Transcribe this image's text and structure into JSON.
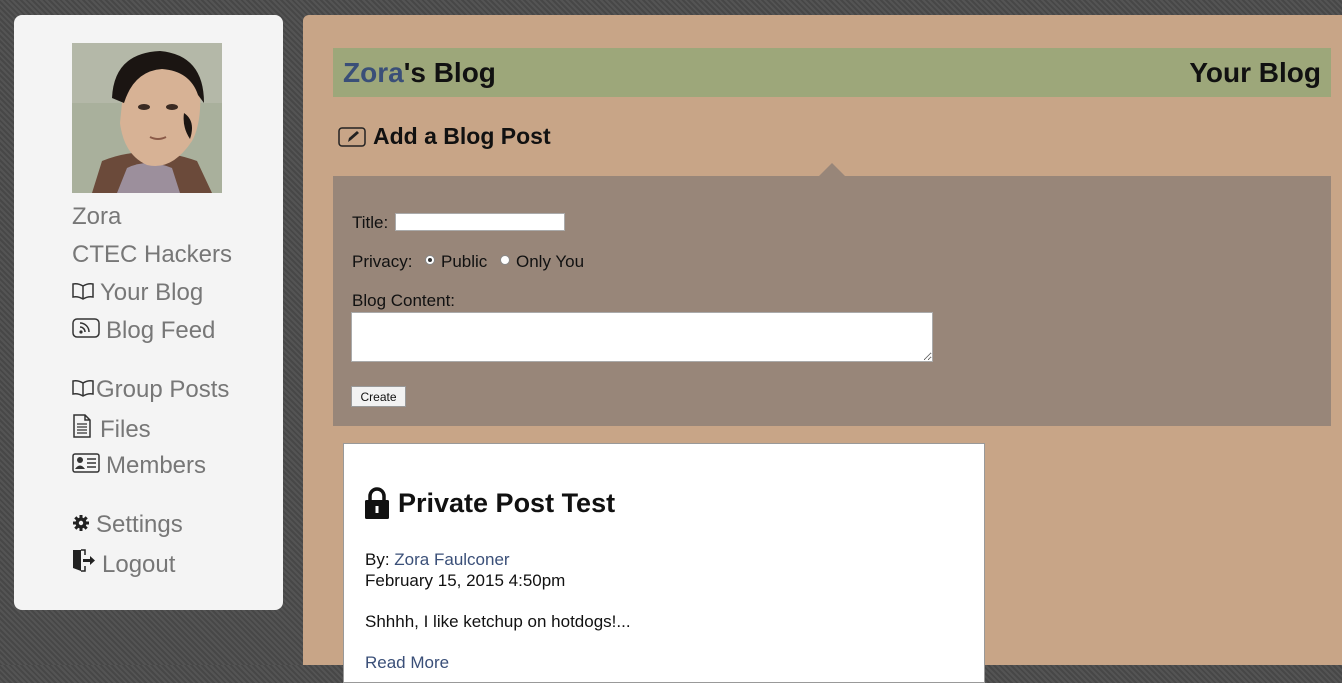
{
  "sidebar": {
    "user_name": "Zora",
    "group_name": "CTEC Hackers",
    "items": [
      {
        "label": "Your Blog",
        "icon": "book-icon"
      },
      {
        "label": "Blog Feed",
        "icon": "rss-icon"
      },
      {
        "label": "Group Posts",
        "icon": "book-icon"
      },
      {
        "label": "Files",
        "icon": "document-icon"
      },
      {
        "label": "Members",
        "icon": "id-card-icon"
      },
      {
        "label": "Settings",
        "icon": "gear-icon"
      },
      {
        "label": "Logout",
        "icon": "door-exit-icon"
      }
    ]
  },
  "header": {
    "owner_name": "Zora",
    "title_suffix": "'s Blog",
    "right_label": "Your Blog"
  },
  "add_post": {
    "heading": "Add a Blog Post",
    "title_label": "Title:",
    "title_value": "",
    "privacy_label": "Privacy:",
    "privacy_options": [
      "Public",
      "Only You"
    ],
    "privacy_selected": "Public",
    "content_label": "Blog Content:",
    "content_value": "",
    "create_label": "Create"
  },
  "post": {
    "title": "Private Post Test",
    "by_label": "By: ",
    "author": "Zora Faulconer",
    "date": "February 15, 2015 4:50pm",
    "excerpt": "Shhhh, I like ketchup on hotdogs!...",
    "read_more": "Read More"
  },
  "colors": {
    "main_background": "#c8a587",
    "header_background": "#9da77a",
    "form_panel": "#988679",
    "link": "#3a4f78"
  }
}
